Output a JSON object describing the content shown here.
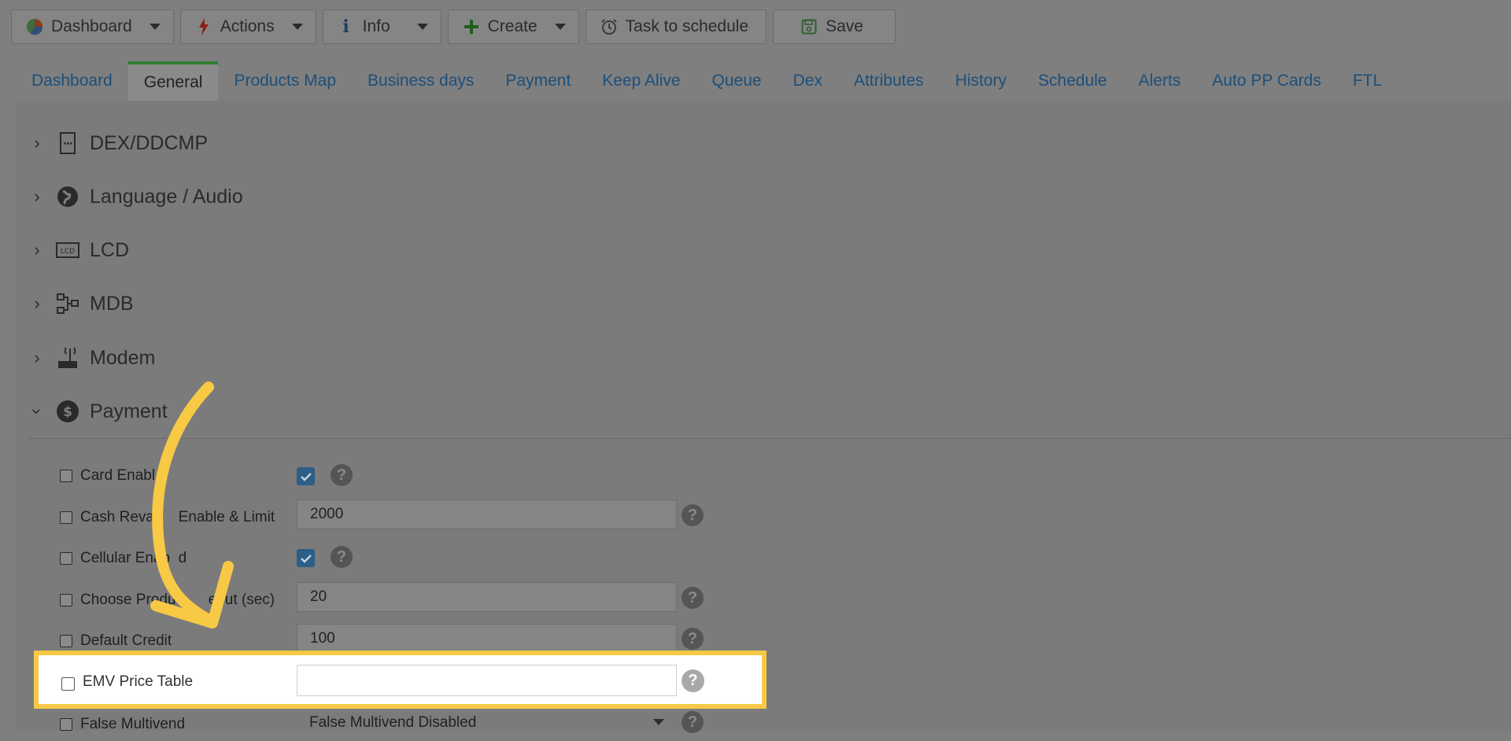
{
  "toolbar": {
    "dashboard": "Dashboard",
    "actions": "Actions",
    "info": "Info",
    "create": "Create",
    "task_to_schedule": "Task to schedule",
    "save": "Save"
  },
  "tabs": [
    "Dashboard",
    "General",
    "Products Map",
    "Business days",
    "Payment",
    "Keep Alive",
    "Queue",
    "Dex",
    "Attributes",
    "History",
    "Schedule",
    "Alerts",
    "Auto PP Cards",
    "FTL"
  ],
  "active_tab": "General",
  "sections": {
    "dex": "DEX/DDCMP",
    "language": "Language / Audio",
    "lcd": "LCD",
    "mdb": "MDB",
    "modem": "Modem",
    "payment": "Payment"
  },
  "payment_rows": {
    "card_enable": {
      "label": "Card Enabl",
      "checked": true
    },
    "cash_revalue": {
      "label": "Cash Reval     Enable & Limit",
      "value": "2000"
    },
    "cellular": {
      "label": "Cellular Enab  d",
      "checked": true
    },
    "choose_product": {
      "label": "Choose Produc      eout (sec)",
      "value": "20"
    },
    "default_credit": {
      "label": "Default Credit",
      "value": "100"
    },
    "emv_price_table": {
      "label": "EMV Price Table",
      "value": ""
    },
    "false_multivend": {
      "label": "False Multivend",
      "value": "False Multivend Disabled"
    }
  },
  "help_glyph": "?",
  "colors": {
    "highlight": "#f7c945",
    "link": "#1c4f7a",
    "active_tab_border": "#2e7d32",
    "checkbox_checked": "#2c5e86"
  }
}
